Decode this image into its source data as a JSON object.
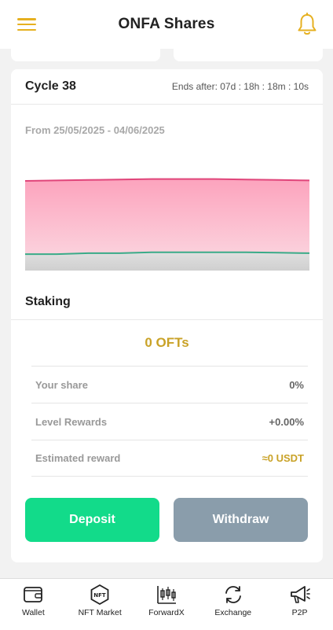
{
  "header": {
    "title": "ONFA Shares",
    "menu_icon": "hamburger-menu-icon",
    "notification_icon": "bell-icon",
    "accent_color": "#e6b020"
  },
  "cycle": {
    "title": "Cycle 38",
    "ends_after": "Ends after: 07d : 18h : 18m : 10s",
    "date_range": "From 25/05/2025 - 04/06/2025"
  },
  "chart_data": {
    "type": "area",
    "title": "",
    "xlabel": "",
    "ylabel": "",
    "grid": false,
    "legend": "none",
    "series": [
      {
        "values": [
          0.98,
          0.985,
          0.99,
          0.995,
          1.0,
          1.0,
          1.0,
          0.995,
          0.99,
          0.985
        ],
        "color": "#e0457a",
        "fill": "#fbb6c9"
      },
      {
        "values": [
          0.18,
          0.18,
          0.19,
          0.19,
          0.2,
          0.2,
          0.2,
          0.2,
          0.195,
          0.19
        ],
        "color": "#3aab88",
        "fill": "#d9d9d9"
      }
    ],
    "ylim": [
      0,
      1.1
    ]
  },
  "staking": {
    "label": "Staking",
    "amount": "0 OFTs",
    "rows": [
      {
        "label": "Your share",
        "value": "0%"
      },
      {
        "label": "Level Rewards",
        "value": "+0.00%"
      },
      {
        "label": "Estimated reward",
        "value": "≈0 USDT"
      }
    ]
  },
  "actions": {
    "deposit": "Deposit",
    "withdraw": "Withdraw",
    "deposit_color": "#12db8a",
    "withdraw_color": "#8a9dab"
  },
  "nav": {
    "items": [
      {
        "label": "Wallet",
        "icon": "wallet-icon"
      },
      {
        "label": "NFT Market",
        "icon": "nft-icon"
      },
      {
        "label": "ForwardX",
        "icon": "candlestick-icon"
      },
      {
        "label": "Exchange",
        "icon": "exchange-icon"
      },
      {
        "label": "P2P",
        "icon": "megaphone-icon"
      }
    ]
  }
}
